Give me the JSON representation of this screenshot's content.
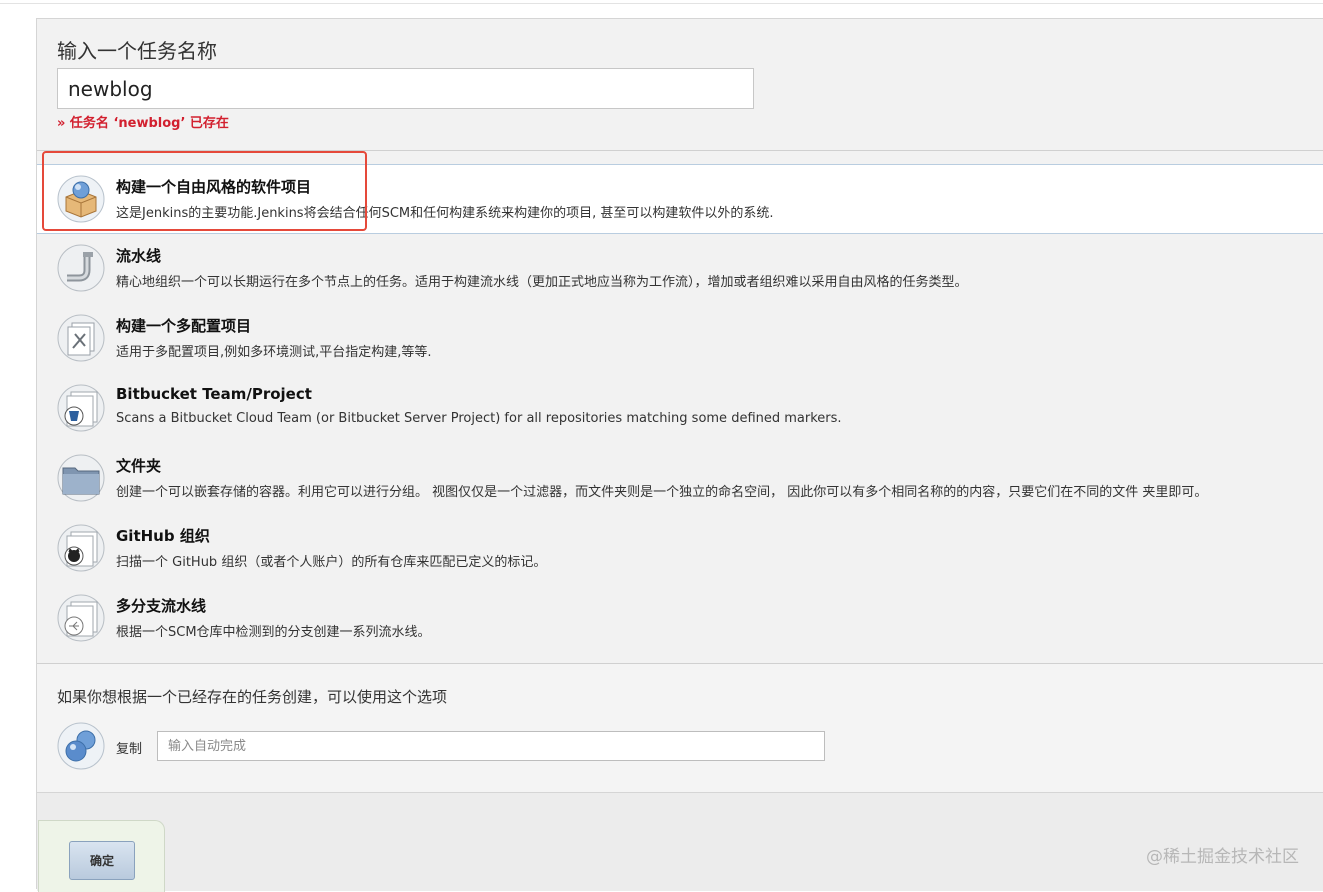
{
  "form": {
    "heading": "输入一个任务名称",
    "name_value": "newblog",
    "error": "» 任务名 ‘newblog’ 已存在"
  },
  "items": [
    {
      "title": "构建一个自由风格的软件项目",
      "desc": "这是Jenkins的主要功能.Jenkins将会结合任何SCM和任何构建系统来构建你的项目, 甚至可以构建软件以外的系统.",
      "icon": "freestyle-box-icon",
      "selected": true
    },
    {
      "title": "流水线",
      "desc": "精心地组织一个可以长期运行在多个节点上的任务。适用于构建流水线（更加正式地应当称为工作流），增加或者组织难以采用自由风格的任务类型。",
      "icon": "pipeline-icon",
      "selected": false
    },
    {
      "title": "构建一个多配置项目",
      "desc": "适用于多配置项目,例如多环境测试,平台指定构建,等等.",
      "icon": "multi-config-icon",
      "selected": false
    },
    {
      "title": "Bitbucket Team/Project",
      "desc": "Scans a Bitbucket Cloud Team (or Bitbucket Server Project) for all repositories matching some defined markers.",
      "icon": "bitbucket-icon",
      "selected": false
    },
    {
      "title": "文件夹",
      "desc": "创建一个可以嵌套存储的容器。利用它可以进行分组。 视图仅仅是一个过滤器，而文件夹则是一个独立的命名空间， 因此你可以有多个相同名称的的内容，只要它们在不同的文件 夹里即可。",
      "icon": "folder-icon",
      "selected": false
    },
    {
      "title": "GitHub 组织",
      "desc": "扫描一个 GitHub 组织（或者个人账户）的所有仓库来匹配已定义的标记。",
      "icon": "github-icon",
      "selected": false
    },
    {
      "title": "多分支流水线",
      "desc": "根据一个SCM仓库中检测到的分支创建一系列流水线。",
      "icon": "multibranch-icon",
      "selected": false
    }
  ],
  "copy": {
    "hint": "如果你想根据一个已经存在的任务创建，可以使用这个选项",
    "label": "复制",
    "placeholder": "输入自动完成"
  },
  "ok_label": "确定",
  "watermark": "@稀土掘金技术社区",
  "colors": {
    "error": "#d2202f",
    "highlight": "#e5493a",
    "selected_border": "#b9cde0"
  }
}
